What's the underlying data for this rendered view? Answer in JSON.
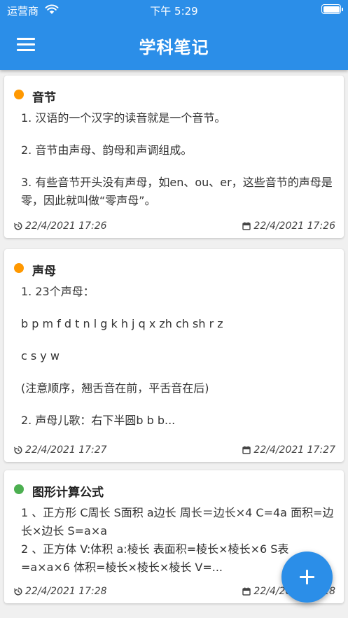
{
  "status_bar": {
    "carrier": "运营商",
    "time": "下午 5:29"
  },
  "header": {
    "title": "学科笔记"
  },
  "notes": [
    {
      "dot_color": "#ff9800",
      "title": "音节",
      "lines": [
        "1. 汉语的一个汉字的读音就是一个音节。",
        "2. 音节由声母、韵母和声调组成。",
        "3. 有些音节开头没有声母，如en、ou、er，这些音节的声母是零，因此就叫做“零声母”。"
      ],
      "created": "22/4/2021 17:26",
      "modified": "22/4/2021 17:26"
    },
    {
      "dot_color": "#ff9800",
      "title": "声母",
      "lines": [
        "1. 23个声母：",
        "b p m f d t n l g k h j q x zh ch sh r z",
        "c s y w",
        "(注意顺序，翘舌音在前，平舌音在后)",
        "2. 声母儿歌：右下半圆b b b..."
      ],
      "created": "22/4/2021 17:27",
      "modified": "22/4/2021 17:27"
    },
    {
      "dot_color": "#4caf50",
      "title": "图形计算公式",
      "lines": [
        "1 、正方形 C周长 S面积 a边长 周长＝边长×4 C=4a 面积=边长×边长 S=a×a",
        "2 、正方体 V:体积 a:棱长 表面积=棱长×棱长×6 S表=a×a×6 体积=棱长×棱长×棱长 V=..."
      ],
      "created": "22/4/2021 17:28",
      "modified": "22/4/2021 17:28"
    }
  ]
}
